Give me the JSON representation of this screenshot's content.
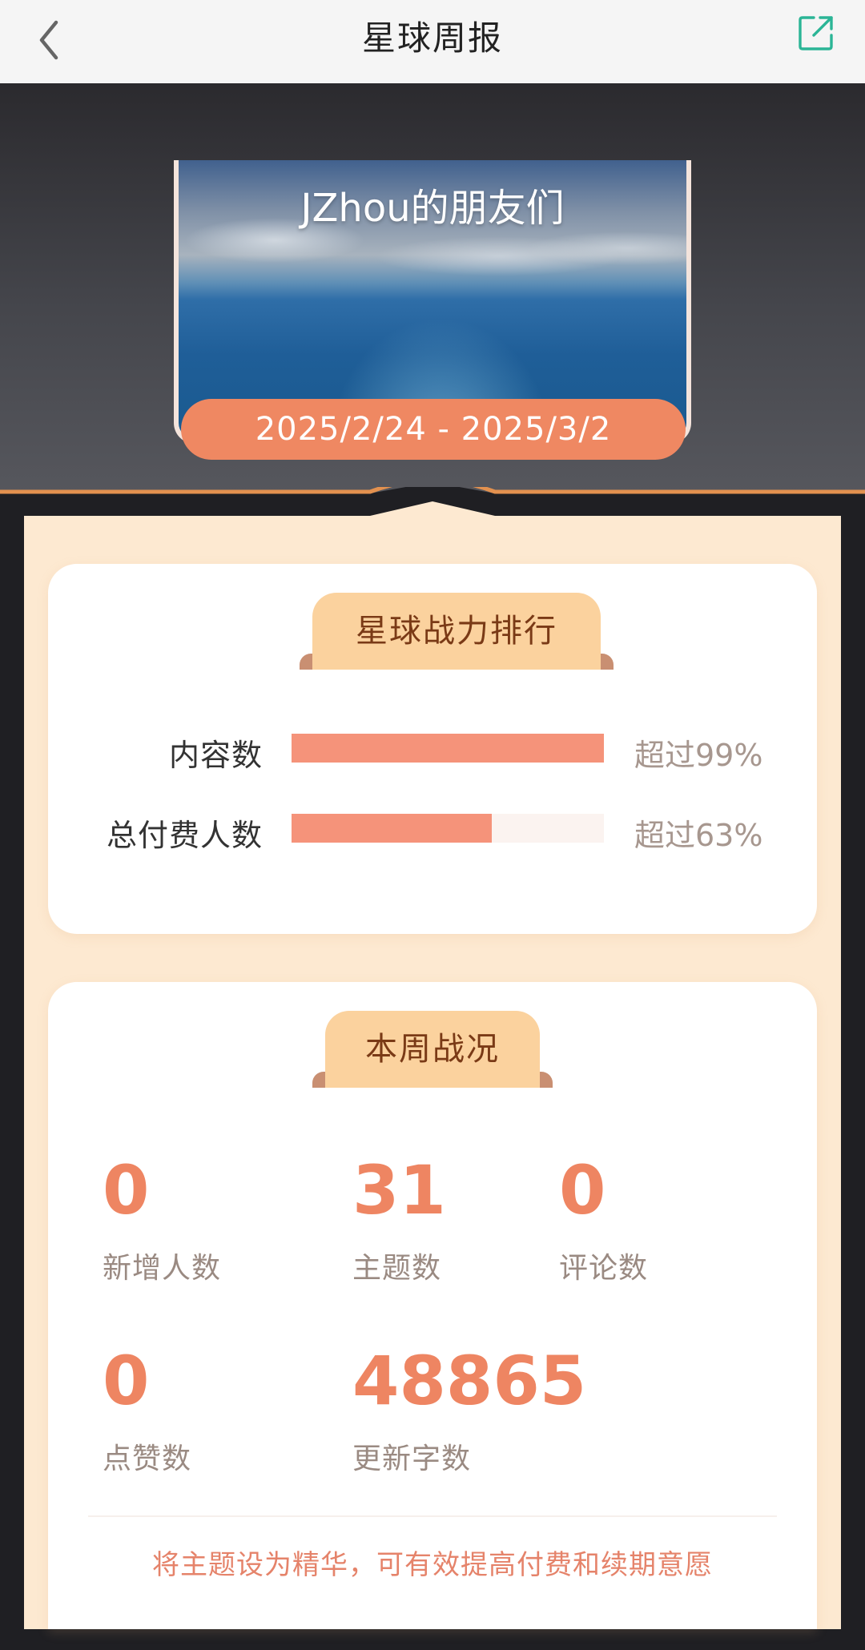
{
  "nav": {
    "title": "星球周报",
    "back_icon": "chevron-left-icon",
    "share_icon": "share-external-icon",
    "share_color": "#2bb596"
  },
  "hero": {
    "cover_title": "JZhou的朋友们",
    "date_range": "2025/2/24 - 2025/3/2",
    "accent": "#ef8862"
  },
  "ranking": {
    "title": "星球战力排行",
    "rows": [
      {
        "label": "内容数",
        "fill": 1.0,
        "value": "超过99%"
      },
      {
        "label": "总付费人数",
        "fill": 0.64,
        "value": "超过63%"
      }
    ]
  },
  "weekly": {
    "title": "本周战况",
    "stats": [
      {
        "value": "0",
        "label": "新增人数"
      },
      {
        "value": "31",
        "label": "主题数"
      },
      {
        "value": "0",
        "label": "评论数"
      },
      {
        "value": "0",
        "label": "点赞数"
      },
      {
        "value": "48865",
        "label": "更新字数"
      }
    ],
    "tip": "将主题设为精华，可有效提高付费和续期意愿"
  }
}
